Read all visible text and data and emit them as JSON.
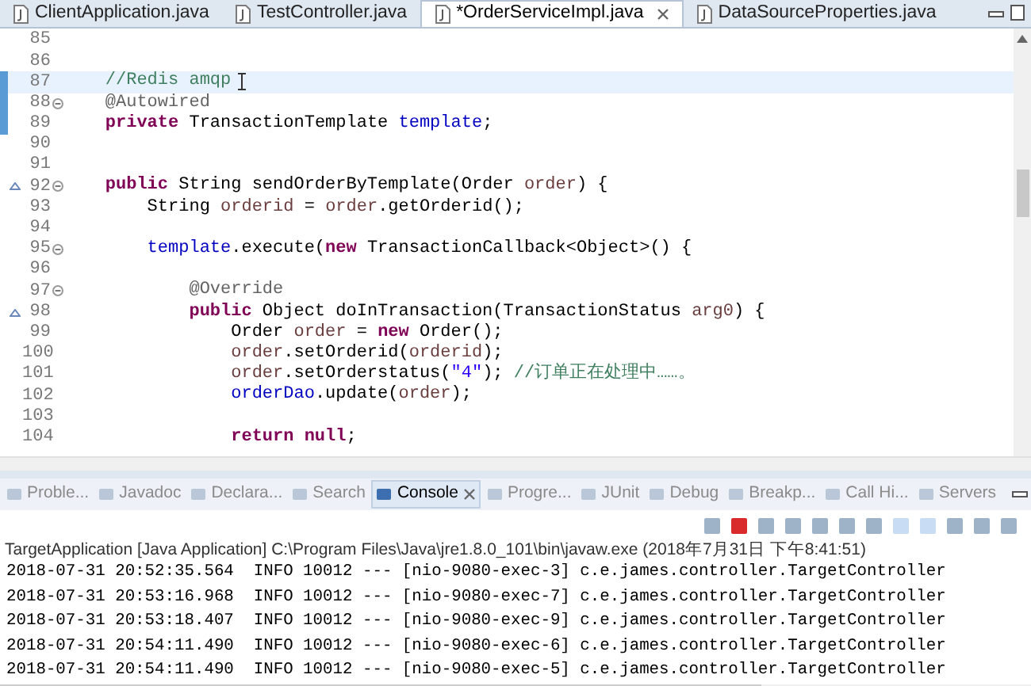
{
  "editor_tabs": [
    {
      "label": "ClientApplication.java",
      "selected": false
    },
    {
      "label": "TestController.java",
      "selected": false
    },
    {
      "label": "*OrderServiceImpl.java",
      "selected": true
    },
    {
      "label": "DataSourceProperties.java",
      "selected": false
    }
  ],
  "code_lines": [
    {
      "number": "85",
      "current": false,
      "changed": false,
      "fold": false,
      "override": false
    },
    {
      "number": "86",
      "current": false,
      "changed": false,
      "fold": false,
      "override": false
    },
    {
      "number": "87",
      "current": true,
      "changed": true,
      "fold": false,
      "override": false,
      "tokens": [
        {
          "kind": "comment",
          "text": "    //Redis amqp"
        }
      ]
    },
    {
      "number": "88",
      "current": false,
      "changed": true,
      "fold": true,
      "override": false,
      "tokens": [
        {
          "kind": "annotation",
          "text": "    @Autowired"
        }
      ]
    },
    {
      "number": "89",
      "current": false,
      "changed": true,
      "fold": false,
      "override": false,
      "tokens": [
        {
          "kind": "keyword",
          "text": "    private"
        },
        {
          "kind": "plain",
          "text": " TransactionTemplate "
        },
        {
          "kind": "field",
          "text": "template"
        },
        {
          "kind": "plain",
          "text": ";"
        }
      ]
    },
    {
      "number": "90",
      "current": false,
      "changed": false,
      "fold": false,
      "override": false
    },
    {
      "number": "91",
      "current": false,
      "changed": false,
      "fold": false,
      "override": false
    },
    {
      "number": "92",
      "current": false,
      "changed": false,
      "fold": true,
      "override": true,
      "tokens": [
        {
          "kind": "keyword",
          "text": "    public"
        },
        {
          "kind": "plain",
          "text": " String sendOrderByTemplate(Order "
        },
        {
          "kind": "local",
          "text": "order"
        },
        {
          "kind": "plain",
          "text": ") {"
        }
      ]
    },
    {
      "number": "93",
      "current": false,
      "changed": false,
      "fold": false,
      "override": false,
      "tokens": [
        {
          "kind": "plain",
          "text": "        String "
        },
        {
          "kind": "local",
          "text": "orderid"
        },
        {
          "kind": "plain",
          "text": " = "
        },
        {
          "kind": "local",
          "text": "order"
        },
        {
          "kind": "plain",
          "text": ".getOrderid();"
        }
      ]
    },
    {
      "number": "94",
      "current": false,
      "changed": false,
      "fold": false,
      "override": false
    },
    {
      "number": "95",
      "current": false,
      "changed": false,
      "fold": true,
      "override": false,
      "tokens": [
        {
          "kind": "field",
          "text": "        template"
        },
        {
          "kind": "plain",
          "text": ".execute("
        },
        {
          "kind": "keyword",
          "text": "new"
        },
        {
          "kind": "plain",
          "text": " TransactionCallback<Object>() {"
        }
      ]
    },
    {
      "number": "96",
      "current": false,
      "changed": false,
      "fold": false,
      "override": false
    },
    {
      "number": "97",
      "current": false,
      "changed": false,
      "fold": true,
      "override": false,
      "tokens": [
        {
          "kind": "annotation",
          "text": "            @Override"
        }
      ]
    },
    {
      "number": "98",
      "current": false,
      "changed": false,
      "fold": false,
      "override": true,
      "tokens": [
        {
          "kind": "keyword",
          "text": "            public"
        },
        {
          "kind": "plain",
          "text": " Object doInTransaction(TransactionStatus "
        },
        {
          "kind": "local",
          "text": "arg0"
        },
        {
          "kind": "plain",
          "text": ") {"
        }
      ]
    },
    {
      "number": "99",
      "current": false,
      "changed": false,
      "fold": false,
      "override": false,
      "tokens": [
        {
          "kind": "plain",
          "text": "                Order "
        },
        {
          "kind": "local",
          "text": "order"
        },
        {
          "kind": "plain",
          "text": " = "
        },
        {
          "kind": "keyword",
          "text": "new"
        },
        {
          "kind": "plain",
          "text": " Order();"
        }
      ]
    },
    {
      "number": "100",
      "current": false,
      "changed": false,
      "fold": false,
      "override": false,
      "tokens": [
        {
          "kind": "local",
          "text": "                order"
        },
        {
          "kind": "plain",
          "text": ".setOrderid("
        },
        {
          "kind": "local",
          "text": "orderid"
        },
        {
          "kind": "plain",
          "text": ");"
        }
      ]
    },
    {
      "number": "101",
      "current": false,
      "changed": false,
      "fold": false,
      "override": false,
      "tokens": [
        {
          "kind": "local",
          "text": "                order"
        },
        {
          "kind": "plain",
          "text": ".setOrderstatus("
        },
        {
          "kind": "string",
          "text": "\"4\""
        },
        {
          "kind": "plain",
          "text": "); "
        },
        {
          "kind": "comment",
          "text": "//订单正在处理中……。"
        }
      ]
    },
    {
      "number": "102",
      "current": false,
      "changed": false,
      "fold": false,
      "override": false,
      "tokens": [
        {
          "kind": "field",
          "text": "                orderDao"
        },
        {
          "kind": "plain",
          "text": ".update("
        },
        {
          "kind": "local",
          "text": "order"
        },
        {
          "kind": "plain",
          "text": ");"
        }
      ]
    },
    {
      "number": "103",
      "current": false,
      "changed": false,
      "fold": false,
      "override": false
    },
    {
      "number": "104",
      "current": false,
      "changed": false,
      "fold": false,
      "override": false,
      "tokens": [
        {
          "kind": "keyword",
          "text": "                return null"
        },
        {
          "kind": "plain",
          "text": ";"
        }
      ]
    }
  ],
  "view_tabs": [
    {
      "label": "Proble...",
      "selected": false
    },
    {
      "label": "Javadoc",
      "selected": false
    },
    {
      "label": "Declara...",
      "selected": false
    },
    {
      "label": "Search",
      "selected": false
    },
    {
      "label": "Console",
      "selected": true
    },
    {
      "label": "Progre...",
      "selected": false
    },
    {
      "label": "JUnit",
      "selected": false
    },
    {
      "label": "Debug",
      "selected": false
    },
    {
      "label": "Breakp...",
      "selected": false
    },
    {
      "label": "Call Hi...",
      "selected": false
    },
    {
      "label": "Servers",
      "selected": false
    }
  ],
  "console": {
    "title": "TargetApplication [Java Application] C:\\Program Files\\Java\\jre1.8.0_101\\bin\\javaw.exe (2018年7月31日 下午8:41:51)",
    "lines": [
      "2018-07-31 20:52:35.564  INFO 10012 --- [nio-9080-exec-3] c.e.james.controller.TargetController",
      "2018-07-31 20:53:16.968  INFO 10012 --- [nio-9080-exec-7] c.e.james.controller.TargetController",
      "2018-07-31 20:53:18.407  INFO 10012 --- [nio-9080-exec-9] c.e.james.controller.TargetController",
      "2018-07-31 20:54:11.490  INFO 10012 --- [nio-9080-exec-6] c.e.james.controller.TargetController",
      "2018-07-31 20:54:11.490  INFO 10012 --- [nio-9080-exec-5] c.e.james.controller.TargetController"
    ]
  }
}
